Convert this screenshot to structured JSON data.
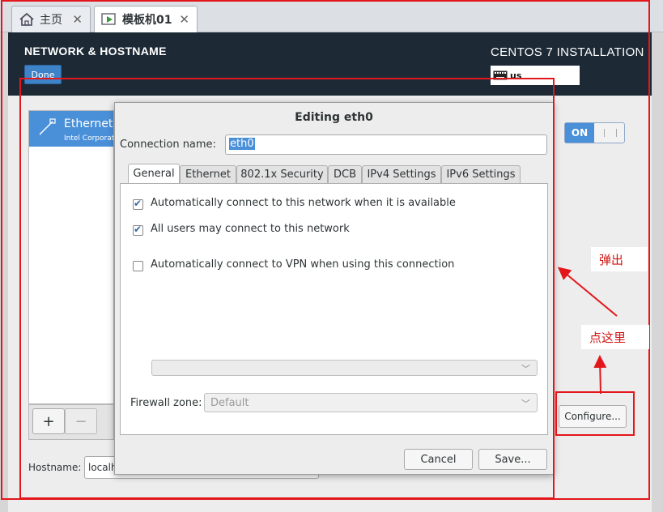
{
  "vm_tabs": [
    {
      "label": "主页"
    },
    {
      "label": "模板机01"
    }
  ],
  "header": {
    "title": "NETWORK & HOSTNAME",
    "done_label": "Done",
    "installer_title": "CENTOS 7 INSTALLATION",
    "keyboard_layout": "us"
  },
  "network_list": {
    "selected_name": "Ethernet",
    "selected_sub": "Intel Corporation",
    "add_label": "+",
    "remove_label": "−"
  },
  "hostname": {
    "label": "Hostname:",
    "value": "localhost.localdomain"
  },
  "toggle": {
    "label": "ON"
  },
  "configure_label": "Configure...",
  "dialog": {
    "title": "Editing eth0",
    "connection_name_label": "Connection name:",
    "connection_name_value": "eth0",
    "tabs": [
      "General",
      "Ethernet",
      "802.1x Security",
      "DCB",
      "IPv4 Settings",
      "IPv6 Settings"
    ],
    "options": [
      {
        "label": "Automatically connect to this network when it is available",
        "checked": true
      },
      {
        "label": "All users may connect to this network",
        "checked": true
      },
      {
        "label": "Automatically connect to VPN when using this connection",
        "checked": false
      }
    ],
    "vpn_select_value": "",
    "firewall_label": "Firewall zone:",
    "firewall_value": "Default",
    "cancel_label": "Cancel",
    "save_label": "Save..."
  },
  "annotations": {
    "popup_note": "弹出",
    "click_note": "点这里",
    "color": "#e3171b"
  }
}
